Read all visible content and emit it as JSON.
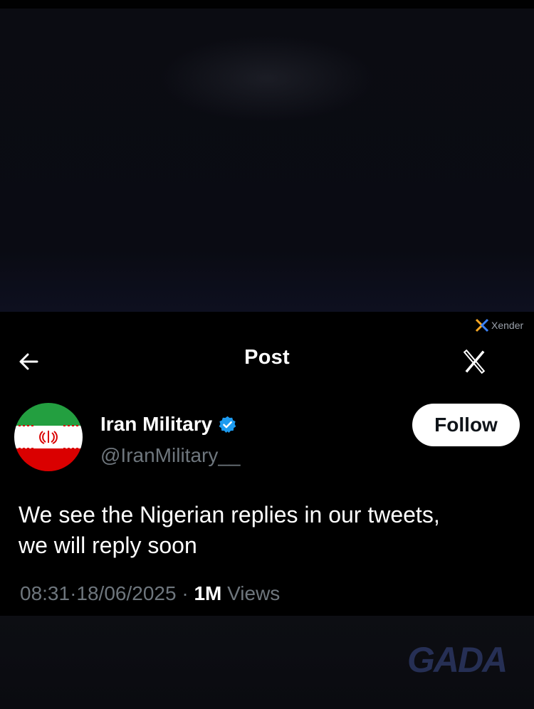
{
  "header": {
    "title": "Post"
  },
  "watermarks": {
    "xender": "Xender",
    "gada": "GADA"
  },
  "post": {
    "author": {
      "display_name": "Iran Military",
      "handle": "@IranMilitary__",
      "verified": true,
      "avatar": "iran-flag"
    },
    "follow_label": "Follow",
    "text_line1": "We see the Nigerian replies in our tweets,",
    "text_line2": "we will reply soon",
    "time": "08:31",
    "date": "18/06/2025",
    "views_count": "1M",
    "views_label": "Views"
  },
  "colors": {
    "background": "#000000",
    "text_primary": "#ffffff",
    "text_secondary": "#6e767d",
    "verified_blue": "#1d9bf0",
    "follow_bg": "#ffffff",
    "flag_green": "#239f40",
    "flag_red": "#da0000"
  },
  "icons": {
    "back": "arrow-left-icon",
    "close": "x-logo-icon",
    "verified": "verified-badge-icon"
  }
}
